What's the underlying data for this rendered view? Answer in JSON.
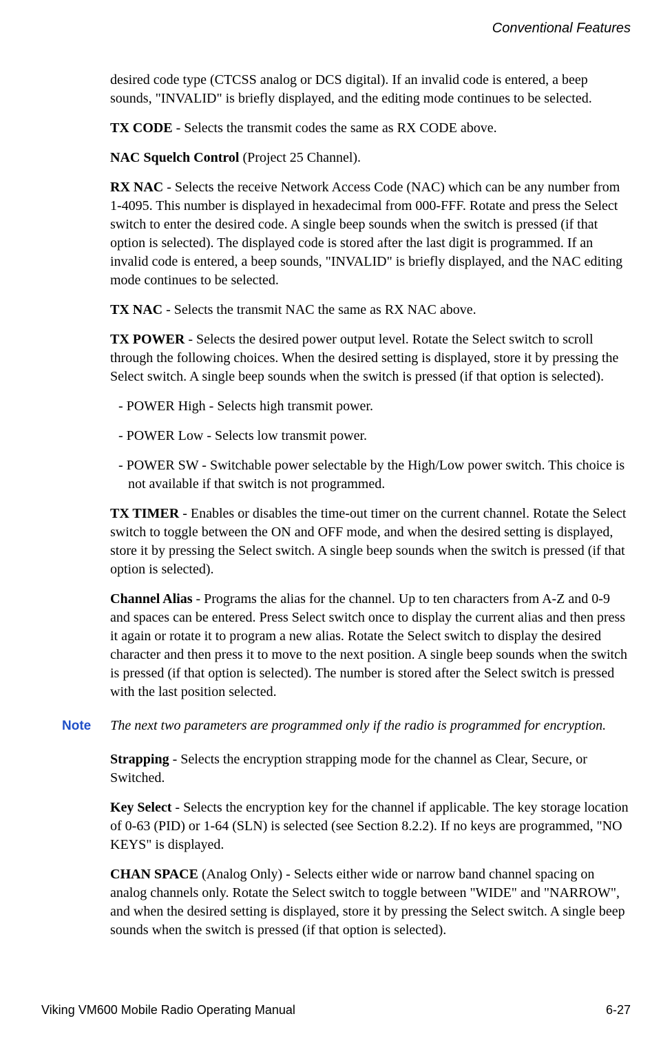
{
  "header": "Conventional Features",
  "paragraphs": {
    "p1": "desired code type (CTCSS analog or DCS digital). If an invalid code is entered, a beep sounds, \"INVALID\" is briefly displayed, and the editing mode continues to be selected.",
    "p2_bold": "TX CODE",
    "p2_text": " - Selects the transmit codes the same as RX CODE above.",
    "p3_bold": "NAC Squelch Control",
    "p3_text": " (Project 25 Channel).",
    "p4_bold": "RX NAC",
    "p4_text": " - Selects the receive Network Access Code (NAC) which can be any number from 1-4095. This number is displayed in hexadecimal from 000-FFF. Rotate and press the Select switch to enter the desired code. A single beep sounds when the switch is pressed (if that option is selected). The displayed code is stored after the last digit is programmed. If an invalid code is entered, a beep sounds, \"INVALID\" is briefly displayed, and the NAC editing mode continues to be selected.",
    "p5_bold": "TX NAC",
    "p5_text": " - Selects the transmit NAC the same as RX NAC above.",
    "p6_bold": "TX POWER",
    "p6_text": " - Selects the desired power output level. Rotate the Select switch to scroll through the following choices. When the desired setting is displayed, store it by pressing the Select switch. A single beep sounds when the switch is pressed (if that option is selected).",
    "li1": "- POWER High - Selects high transmit power.",
    "li2": "- POWER Low - Selects low transmit power.",
    "li3": "- POWER SW - Switchable power selectable by the High/Low power switch. This choice is not available if that switch is not programmed.",
    "p7_bold": "TX TIMER",
    "p7_text": " - Enables or disables the time-out timer on the current channel. Rotate the Select switch to toggle between the ON and OFF mode, and when the desired setting is displayed, store it by pressing the Select switch. A single beep sounds when the switch is pressed (if that option is selected).",
    "p8_bold": "Channel Alias",
    "p8_text": " - Programs the alias for the channel. Up to ten characters from A-Z and 0-9 and spaces can be entered. Press Select switch once to display the current alias and then press it again or rotate it to program a new alias. Rotate the Select switch to display the desired character and then press it to move to the next position. A single beep sounds when the switch is pressed (if that option is selected). The number is stored after the Select switch is pressed with the last position selected.",
    "note_label": "Note",
    "note_text": "The next two parameters are programmed only if the radio is programmed for encryption.",
    "p9_bold": "Strapping",
    "p9_text": " - Selects the encryption strapping mode for the channel as Clear, Secure, or Switched.",
    "p10_bold": "Key Select",
    "p10_text": " - Selects the encryption key for the channel if applicable. The key storage location of 0-63 (PID) or 1-64 (SLN) is selected (see Section 8.2.2). If no keys are programmed, \"NO KEYS\" is displayed.",
    "p11_bold": "CHAN SPACE",
    "p11_text": " (Analog Only) - Selects either wide or narrow band channel spacing on analog channels only. Rotate the Select switch to toggle between \"WIDE\" and \"NARROW\", and when the desired setting is displayed, store it by pressing the Select switch. A single beep sounds when the switch is pressed (if that option is selected)."
  },
  "footer": {
    "left": "Viking VM600 Mobile Radio Operating Manual",
    "right": "6-27"
  }
}
